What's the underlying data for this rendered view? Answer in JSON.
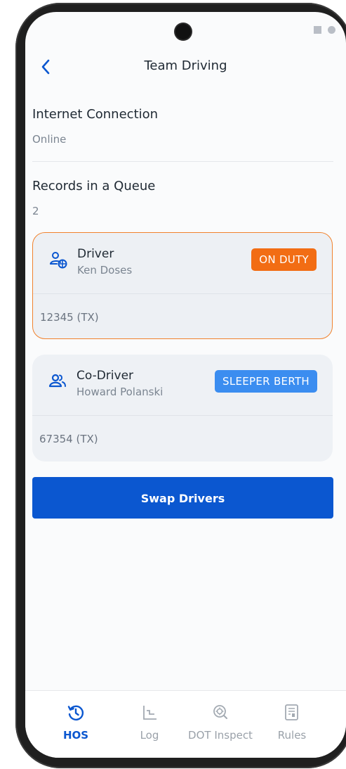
{
  "header": {
    "title": "Team Driving",
    "back_icon": "chevron-left-icon"
  },
  "internet": {
    "label": "Internet Connection",
    "value": "Online"
  },
  "queue": {
    "label": "Records in a Queue",
    "value": "2"
  },
  "drivers": [
    {
      "role": "Driver",
      "name": "Ken Doses",
      "status": "ON DUTY",
      "status_color": "#f26d14",
      "id": "12345 (TX)",
      "icon": "driver-user-icon",
      "active": true
    },
    {
      "role": "Co-Driver",
      "name": "Howard Polanski",
      "status": "SLEEPER BERTH",
      "status_color": "#3b8df0",
      "id": "67354 (TX)",
      "icon": "co-driver-users-icon",
      "active": false
    }
  ],
  "swap_button": "Swap Drivers",
  "nav": [
    {
      "label": "HOS",
      "icon": "history-clock-icon",
      "active": true
    },
    {
      "label": "Log",
      "icon": "log-chart-icon",
      "active": false
    },
    {
      "label": "DOT Inspect",
      "icon": "inspect-search-icon",
      "active": false
    },
    {
      "label": "Rules",
      "icon": "rules-document-icon",
      "active": false
    }
  ],
  "colors": {
    "accent": "#0b57d0",
    "active_border": "#f1822d"
  }
}
